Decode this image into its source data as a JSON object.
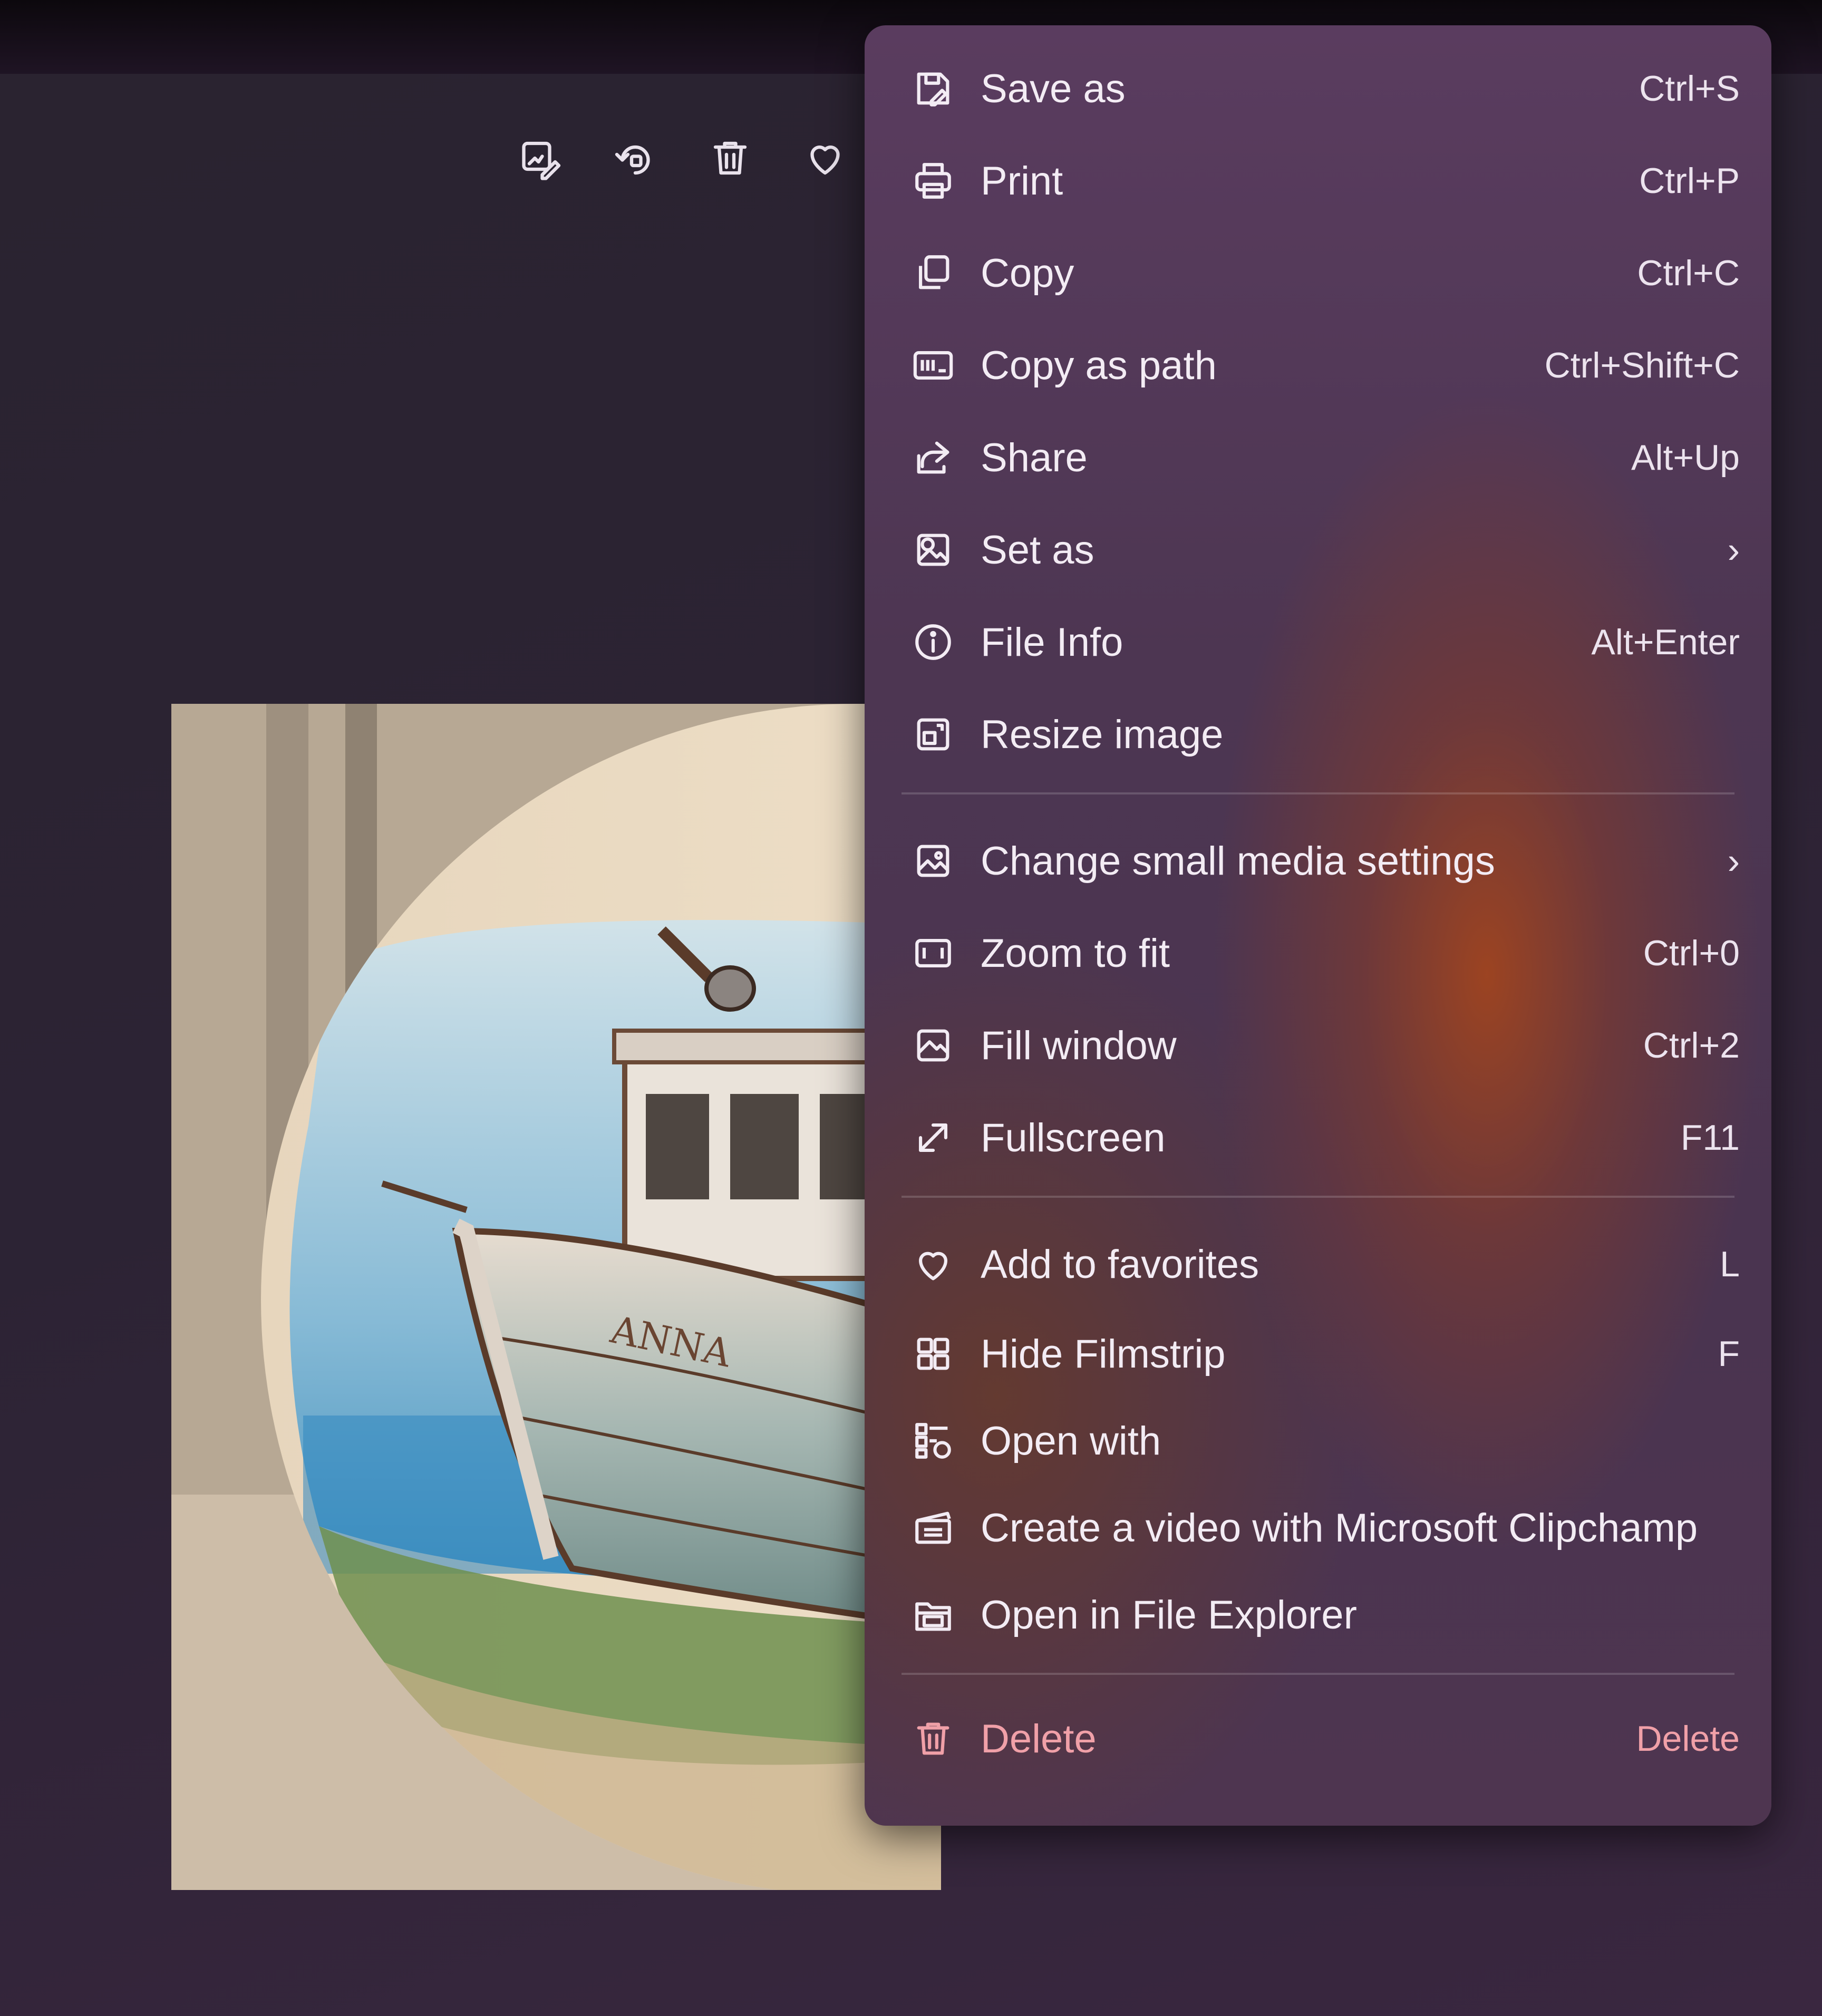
{
  "toolbar": {
    "buttons": [
      {
        "id": "edit",
        "icon": "edit-image-icon"
      },
      {
        "id": "rotate",
        "icon": "rotate-icon"
      },
      {
        "id": "delete",
        "icon": "trash-icon"
      },
      {
        "id": "favorite",
        "icon": "heart-icon"
      }
    ]
  },
  "photo": {
    "boat_name": "ANNA"
  },
  "menu": {
    "items": [
      {
        "label": "Save as",
        "shortcut": "Ctrl+S",
        "icon": "save-as-icon"
      },
      {
        "label": "Print",
        "shortcut": "Ctrl+P",
        "icon": "printer-icon"
      },
      {
        "label": "Copy",
        "shortcut": "Ctrl+C",
        "icon": "copy-icon"
      },
      {
        "label": "Copy as path",
        "shortcut": "Ctrl+Shift+C",
        "icon": "copy-path-icon"
      },
      {
        "label": "Share",
        "shortcut": "Alt+Up",
        "icon": "share-icon"
      },
      {
        "label": "Set as",
        "shortcut": "›",
        "icon": "set-as-icon"
      },
      {
        "label": "File Info",
        "shortcut": "Alt+Enter",
        "icon": "info-icon"
      },
      {
        "label": "Resize image",
        "shortcut": "",
        "icon": "resize-icon"
      },
      {
        "label": "Change small media settings",
        "shortcut": "›",
        "icon": "media-settings-icon"
      },
      {
        "label": "Zoom to fit",
        "shortcut": "Ctrl+0",
        "icon": "zoom-fit-icon"
      },
      {
        "label": "Fill window",
        "shortcut": "Ctrl+2",
        "icon": "fill-window-icon"
      },
      {
        "label": "Fullscreen",
        "shortcut": "F11",
        "icon": "fullscreen-icon"
      },
      {
        "label": "Add to favorites",
        "shortcut": "L",
        "icon": "heart-icon"
      },
      {
        "label": "Hide Filmstrip",
        "shortcut": "F",
        "icon": "filmstrip-icon"
      },
      {
        "label": "Open with",
        "shortcut": "",
        "icon": "open-with-icon"
      },
      {
        "label": "Create a video with Microsoft Clipchamp",
        "shortcut": "",
        "icon": "clipchamp-icon"
      },
      {
        "label": "Open in File Explorer",
        "shortcut": "",
        "icon": "folder-icon"
      },
      {
        "label": "Delete",
        "shortcut": "Delete",
        "icon": "trash-icon"
      }
    ]
  },
  "colors": {
    "menu_text": "#f3ecf4",
    "danger": "#f0a0a8",
    "accent_glow": "#aa4619"
  }
}
